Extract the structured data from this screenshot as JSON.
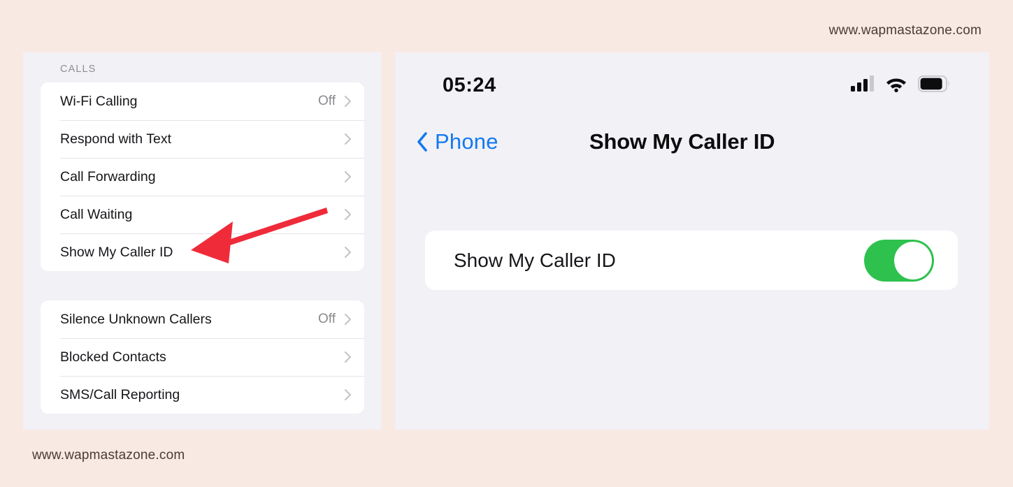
{
  "watermark": {
    "top": "www.wapmastazone.com",
    "bottom": "www.wapmastazone.com"
  },
  "colors": {
    "page_background": "#f9e9e3",
    "panel_background": "#f1f1f6",
    "card_background": "#ffffff",
    "accent_blue": "#1479ef",
    "toggle_on_green": "#2ec14e",
    "annotation_red": "#ef2b3a",
    "secondary_text": "#8a8a8e"
  },
  "settings_panel": {
    "group_header": "CALLS",
    "calls_group": [
      {
        "label": "Wi-Fi Calling",
        "value": "Off",
        "chevron": "chevron-right-icon"
      },
      {
        "label": "Respond with Text",
        "value": "",
        "chevron": "chevron-right-icon"
      },
      {
        "label": "Call Forwarding",
        "value": "",
        "chevron": "chevron-right-icon"
      },
      {
        "label": "Call Waiting",
        "value": "",
        "chevron": "chevron-right-icon"
      },
      {
        "label": "Show My Caller ID",
        "value": "",
        "chevron": "chevron-right-icon"
      }
    ],
    "blocking_group": [
      {
        "label": "Silence Unknown Callers",
        "value": "Off",
        "chevron": "chevron-right-icon"
      },
      {
        "label": "Blocked Contacts",
        "value": "",
        "chevron": "chevron-right-icon"
      },
      {
        "label": "SMS/Call Reporting",
        "value": "",
        "chevron": "chevron-right-icon"
      }
    ],
    "annotation": {
      "name": "red-arrow-pointing-to-show-my-caller-id",
      "points_to": "Show My Caller ID"
    }
  },
  "detail_panel": {
    "status_bar": {
      "time": "05:24",
      "icons": [
        "cellular-signal-icon",
        "wifi-icon",
        "battery-icon"
      ],
      "cellular_bars_filled": 3,
      "cellular_bars_total": 4,
      "battery_level_percent": 85
    },
    "nav_bar": {
      "back_label": "Phone",
      "back_icon": "chevron-left-icon",
      "title": "Show My Caller ID"
    },
    "toggle_row": {
      "label": "Show My Caller ID",
      "state": "on",
      "state_label": "On"
    }
  }
}
